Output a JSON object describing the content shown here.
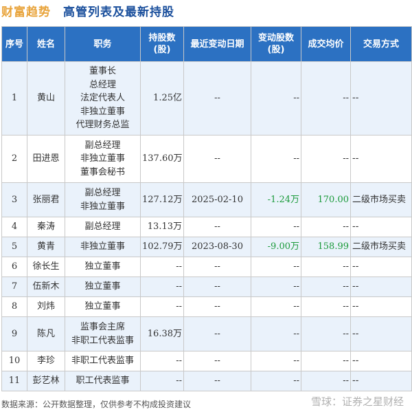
{
  "header": {
    "brand": "财富趋势",
    "title": "高管列表及最新持股"
  },
  "table": {
    "columns": [
      "序号",
      "姓名",
      "职务",
      "持股数(股)",
      "最近变动日期",
      "变动股数(股)",
      "成交均价",
      "交易方式"
    ],
    "rows": [
      {
        "no": "1",
        "name": "黄山",
        "positions": [
          "董事长",
          "总经理",
          "法定代表人",
          "非独立董事",
          "代理财务总监"
        ],
        "shares": "1.25亿",
        "date": "--",
        "change": "--",
        "price": "--",
        "method": "--"
      },
      {
        "no": "2",
        "name": "田进恩",
        "positions": [
          "副总经理",
          "非独立董事",
          "董事会秘书"
        ],
        "shares": "137.60万",
        "date": "--",
        "change": "--",
        "price": "--",
        "method": "--"
      },
      {
        "no": "3",
        "name": "张丽君",
        "positions": [
          "副总经理",
          "非独立董事"
        ],
        "shares": "127.12万",
        "date": "2025-02-10",
        "change": "-1.24万",
        "price": "170.00",
        "method": "二级市场买卖"
      },
      {
        "no": "4",
        "name": "秦涛",
        "positions": [
          "副总经理"
        ],
        "shares": "13.13万",
        "date": "--",
        "change": "--",
        "price": "--",
        "method": "--"
      },
      {
        "no": "5",
        "name": "黄青",
        "positions": [
          "非独立董事"
        ],
        "shares": "102.79万",
        "date": "2023-08-30",
        "change": "-9.00万",
        "price": "158.99",
        "method": "二级市场买卖"
      },
      {
        "no": "6",
        "name": "徐长生",
        "positions": [
          "独立董事"
        ],
        "shares": "--",
        "date": "--",
        "change": "--",
        "price": "--",
        "method": "--"
      },
      {
        "no": "7",
        "name": "伍新木",
        "positions": [
          "独立董事"
        ],
        "shares": "--",
        "date": "--",
        "change": "--",
        "price": "--",
        "method": "--"
      },
      {
        "no": "8",
        "name": "刘炜",
        "positions": [
          "独立董事"
        ],
        "shares": "--",
        "date": "--",
        "change": "--",
        "price": "--",
        "method": "--"
      },
      {
        "no": "9",
        "name": "陈凡",
        "positions": [
          "监事会主席",
          "非职工代表监事"
        ],
        "shares": "16.38万",
        "date": "--",
        "change": "--",
        "price": "--",
        "method": "--"
      },
      {
        "no": "10",
        "name": "李珍",
        "positions": [
          "非职工代表监事"
        ],
        "shares": "--",
        "date": "--",
        "change": "--",
        "price": "--",
        "method": "--"
      },
      {
        "no": "11",
        "name": "彭艺林",
        "positions": [
          "职工代表监事"
        ],
        "shares": "--",
        "date": "--",
        "change": "--",
        "price": "--",
        "method": "--"
      }
    ]
  },
  "footer": {
    "source": "数据来源：公开数据整理，仅供参考不构成投资建议",
    "watermark": "雪球：证券之星财经"
  },
  "colors": {
    "header_bg": "#2c71c2",
    "odd_row_bg": "#eaf2fb",
    "change_color": "#1a9a3a",
    "brand_color": "#e8a33a",
    "title_color": "#1a4f9c"
  }
}
